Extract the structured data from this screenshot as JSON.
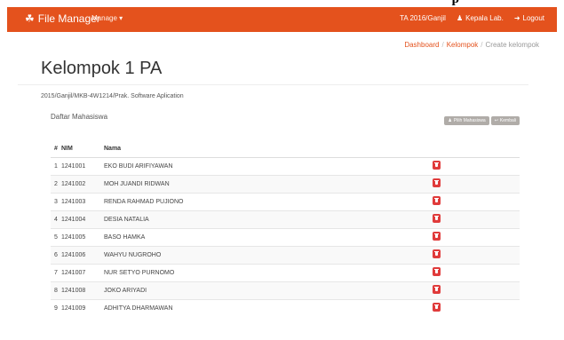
{
  "caption": "p",
  "navbar": {
    "brand": "File Manager",
    "brand_icon": "share-nodes-icon",
    "manage": "Manage",
    "term": "TA 2016/Ganjil",
    "user": "Kepala Lab.",
    "logout": "Logout",
    "color": "#e4521d"
  },
  "breadcrumb": [
    "Dashboard",
    "Kelompok",
    "Create kelompok"
  ],
  "page": {
    "title": "Kelompok 1 PA",
    "subtitle": "2015/Ganjil/MKB-4W1214/Prak. Software Aplication",
    "section": "Daftar Mahasiswa"
  },
  "buttons": {
    "pilih": "Pilih Mahasiswa",
    "kembali": "Kembali"
  },
  "table": {
    "headers": [
      "#",
      "NIM",
      "Nama"
    ],
    "rows": [
      {
        "no": "1",
        "nim": "1241001",
        "nama": "EKO BUDI ARIFIYAWAN"
      },
      {
        "no": "2",
        "nim": "1241002",
        "nama": "MOH JUANDI RIDWAN"
      },
      {
        "no": "3",
        "nim": "1241003",
        "nama": "RENDA RAHMAD PUJIONO"
      },
      {
        "no": "4",
        "nim": "1241004",
        "nama": "DESIA NATALIA"
      },
      {
        "no": "5",
        "nim": "1241005",
        "nama": "BASO HAMKA"
      },
      {
        "no": "6",
        "nim": "1241006",
        "nama": "WAHYU NUGROHO"
      },
      {
        "no": "7",
        "nim": "1241007",
        "nama": "NUR SETYO PURNOMO"
      },
      {
        "no": "8",
        "nim": "1241008",
        "nama": "JOKO ARIYADI"
      },
      {
        "no": "9",
        "nim": "1241009",
        "nama": "ADHITYA DHARMAWAN"
      }
    ]
  },
  "colors": {
    "delete": "#e03b3b",
    "link": "#e4521d",
    "button": "#b0aca8"
  }
}
